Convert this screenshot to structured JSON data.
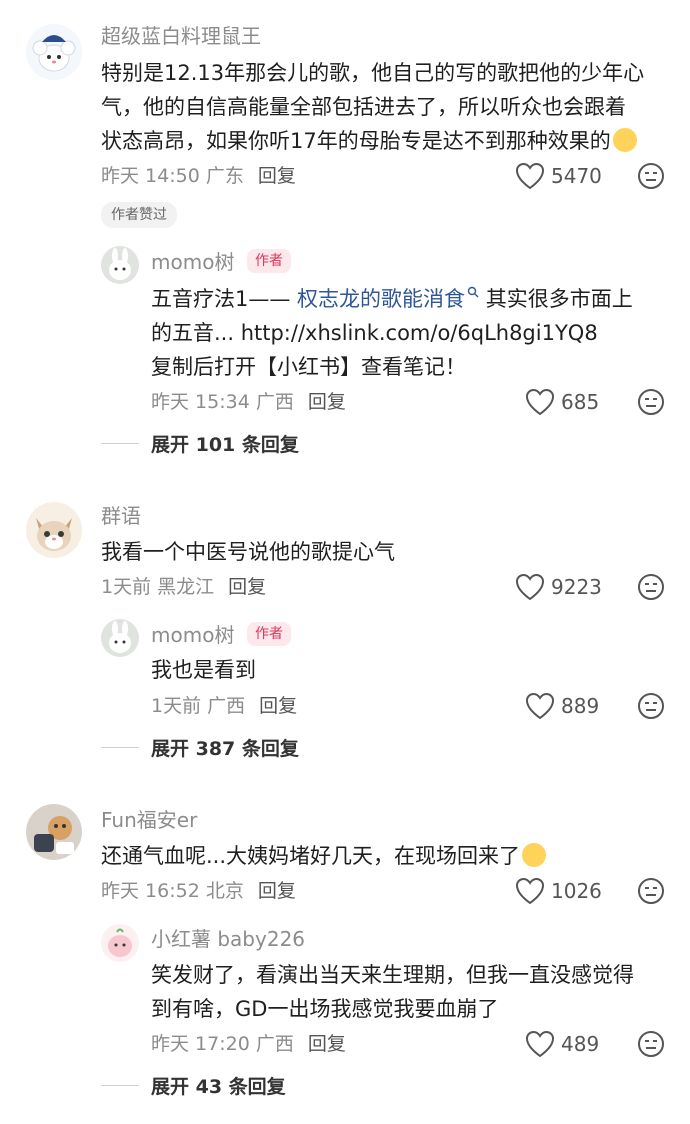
{
  "comments": [
    {
      "username": "超级蓝白料理鼠王",
      "lines": [
        "特别是12.13年那会儿的歌，他自己的写的歌把他的少年心",
        "气，他的自信高能量全部包括进去了，所以听众也会跟着",
        "状态高昂，如果你听17年的母胎专是达不到那种效果的"
      ],
      "time": "昨天 14:50 广东",
      "reply_label": "回复",
      "likes": "5470",
      "badge": "作者赞过",
      "sub": {
        "username": "momo树",
        "author_tag": "作者",
        "line1_prefix": "五音疗法1—— ",
        "line1_link": "权志龙的歌能消食",
        "line1_suffix": " 其实很多市面上",
        "line2": "的五音... http://xhslink.com/o/6qLh8gi1YQ8",
        "line3": "复制后打开【小红书】查看笔记！",
        "time": "昨天 15:34 广西",
        "reply_label": "回复",
        "likes": "685"
      },
      "expand": "展开 101 条回复"
    },
    {
      "username": "群语",
      "lines": [
        "我看一个中医号说他的歌提心气"
      ],
      "time": "1天前 黑龙江",
      "reply_label": "回复",
      "likes": "9223",
      "sub": {
        "username": "momo树",
        "author_tag": "作者",
        "line1": "我也是看到",
        "time": "1天前 广西",
        "reply_label": "回复",
        "likes": "889"
      },
      "expand": "展开 387 条回复"
    },
    {
      "username": "Fun福安er",
      "lines": [
        "还通气血呢...大姨妈堵好几天，在现场回来了"
      ],
      "time": "昨天 16:52 北京",
      "reply_label": "回复",
      "likes": "1026",
      "sub": {
        "username": "小红薯 baby226",
        "line1": "笑发财了，看演出当天来生理期，但我一直没感觉得",
        "line2": "到有啥，GD一出场我感觉我要血崩了",
        "time": "昨天 17:20 广西",
        "reply_label": "回复",
        "likes": "489"
      },
      "expand": "展开 43 条回复"
    }
  ]
}
